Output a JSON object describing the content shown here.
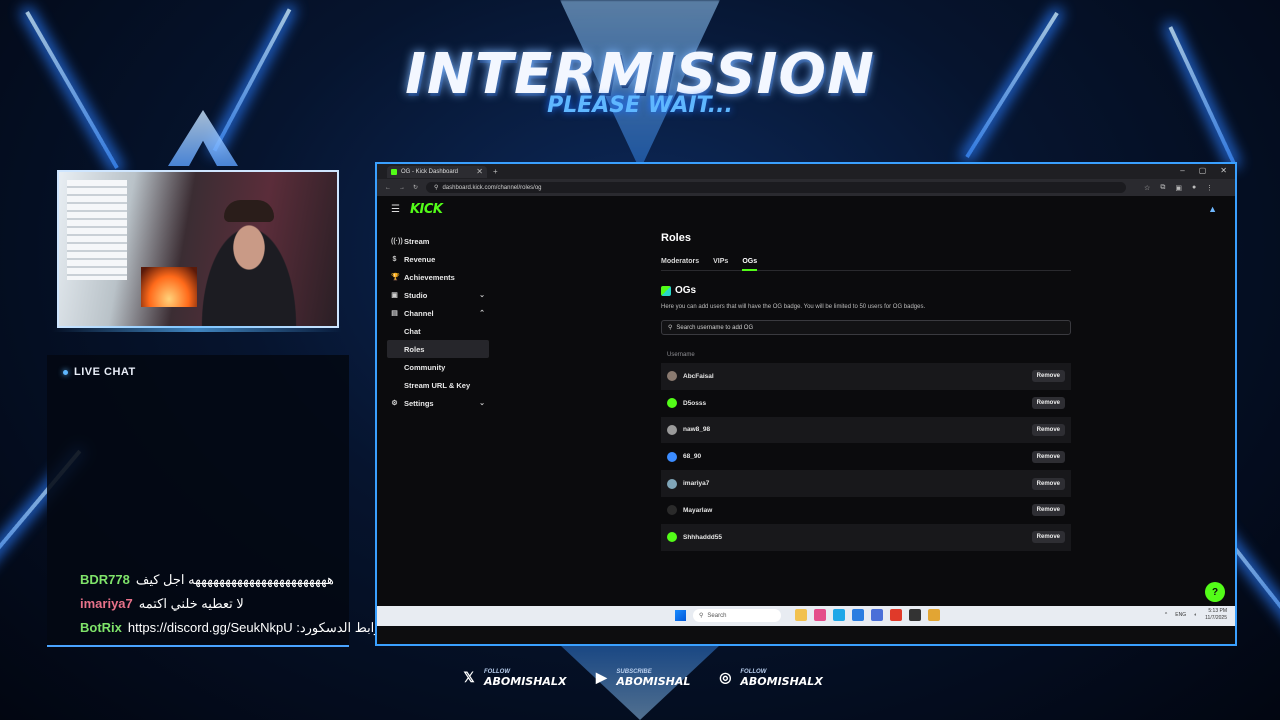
{
  "overlay": {
    "title": "INTERMISSION",
    "subtitle": "PLEASE WAIT...",
    "live_chat_label": "LIVE CHAT",
    "chat_messages": [
      {
        "user": "BDR778",
        "user_color": "#7fe36a",
        "text": "هههههههههههههههههههههههه اجل كيف"
      },
      {
        "user": "imariya7",
        "user_color": "#e8728a",
        "text": "لا تعطيه خلني اكتمه"
      },
      {
        "user": "BotRix",
        "user_color": "#7fe36a",
        "text": "رابط الدسكورد: https://discord.gg/SeukNkpU"
      }
    ],
    "socials": [
      {
        "icon": "x-icon",
        "glyph": "𝕏",
        "small": "FOLLOW",
        "big": "ABOMISHALX"
      },
      {
        "icon": "youtube-icon",
        "glyph": "▶",
        "small": "SUBSCRIBE",
        "big": "ABOMISHAL"
      },
      {
        "icon": "instagram-icon",
        "glyph": "◎",
        "small": "FOLLOW",
        "big": "ABOMISHALX"
      }
    ]
  },
  "browser": {
    "tab_title": "OG - Kick Dashboard",
    "new_tab": "+",
    "url": "dashboard.kick.com/channel/roles/og",
    "win_controls": [
      "–",
      "▢",
      "✕"
    ]
  },
  "kick": {
    "logo": "KICK",
    "sidebar": [
      {
        "label": "Stream",
        "icon": "stream-icon",
        "glyph": "((·))",
        "chevron": "",
        "sub": false,
        "active": false
      },
      {
        "label": "Revenue",
        "icon": "revenue-icon",
        "glyph": "$",
        "chevron": "",
        "sub": false,
        "active": false
      },
      {
        "label": "Achievements",
        "icon": "trophy-icon",
        "glyph": "🏆",
        "chevron": "",
        "sub": false,
        "active": false
      },
      {
        "label": "Studio",
        "icon": "studio-icon",
        "glyph": "▣",
        "chevron": "⌄",
        "sub": false,
        "active": false
      },
      {
        "label": "Channel",
        "icon": "channel-icon",
        "glyph": "▤",
        "chevron": "⌃",
        "sub": false,
        "active": false
      },
      {
        "label": "Chat",
        "icon": "",
        "glyph": "",
        "chevron": "",
        "sub": true,
        "active": false
      },
      {
        "label": "Roles",
        "icon": "",
        "glyph": "",
        "chevron": "",
        "sub": true,
        "active": true
      },
      {
        "label": "Community",
        "icon": "",
        "glyph": "",
        "chevron": "",
        "sub": true,
        "active": false
      },
      {
        "label": "Stream URL & Key",
        "icon": "",
        "glyph": "",
        "chevron": "",
        "sub": true,
        "active": false
      },
      {
        "label": "Settings",
        "icon": "settings-icon",
        "glyph": "⚙",
        "chevron": "⌄",
        "sub": false,
        "active": false
      }
    ],
    "page_title": "Roles",
    "tabs": [
      {
        "label": "Moderators",
        "active": false
      },
      {
        "label": "VIPs",
        "active": false
      },
      {
        "label": "OGs",
        "active": true
      }
    ],
    "section_title": "OGs",
    "description": "Here you can add users that will have the OG badge. You will be limited to 50 users for OG badges.",
    "search_placeholder": "Search username to add OG",
    "column_header": "Username",
    "remove_label": "Remove",
    "users": [
      {
        "name": "AbcFaisal",
        "avatar_color": "#8a7a70"
      },
      {
        "name": "D5osss",
        "avatar_color": "#53fc18"
      },
      {
        "name": "naw8_98",
        "avatar_color": "#9a9a9a"
      },
      {
        "name": "68_90",
        "avatar_color": "#3b8cff"
      },
      {
        "name": "imariya7",
        "avatar_color": "#7fa5b8"
      },
      {
        "name": "Mayarlaw",
        "avatar_color": "#2a2a2a"
      },
      {
        "name": "Shhhaddd55",
        "avatar_color": "#53fc18"
      }
    ],
    "help_glyph": "?"
  },
  "taskbar": {
    "search_label": "Search",
    "apps": [
      "#f2c14e",
      "#e44d8a",
      "#1ea7e8",
      "#2a7de1",
      "#4a6fd8",
      "#e03a2a",
      "#333333",
      "#e2a533"
    ],
    "tray": [
      "^",
      "ENG",
      "◐"
    ],
    "time": "5:13 PM",
    "date": "11/7/2025"
  }
}
